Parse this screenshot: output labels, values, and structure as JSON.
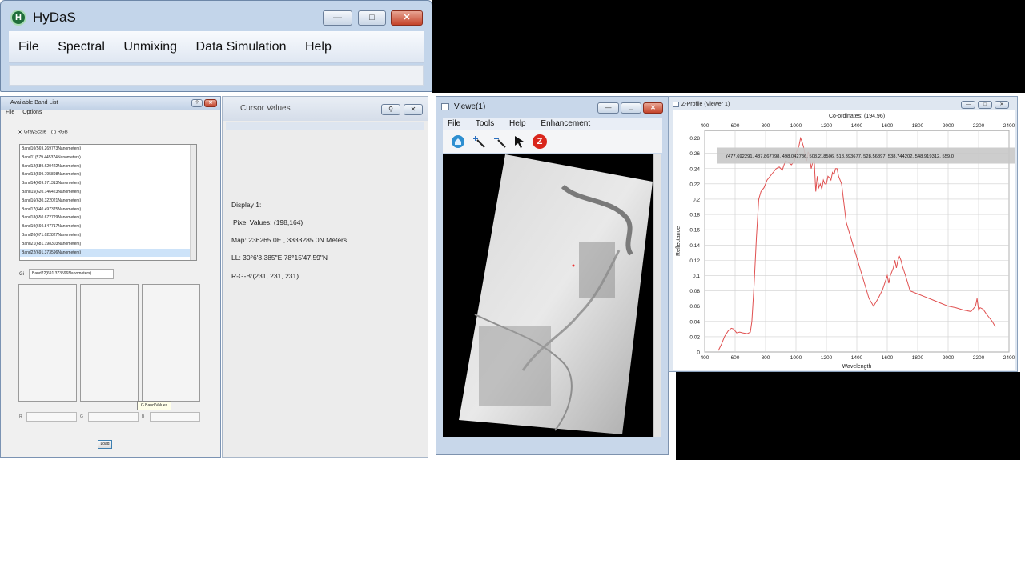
{
  "main_window": {
    "title": "HyDaS",
    "logo_glyph": "H",
    "controls": {
      "minimize": "—",
      "maximize": "□",
      "close": "✕"
    },
    "menu": [
      "File",
      "Spectral",
      "Unmixing",
      "Data Simulation",
      "Help"
    ]
  },
  "band_list_window": {
    "title": "Available Band List",
    "menu": [
      "File",
      "Options"
    ],
    "modes": [
      "GrayScale",
      "RGB"
    ],
    "selected_mode": "GrayScale",
    "bands": [
      "Band10(569.269773Nanometers)",
      "Band11(579.445374Nanometers)",
      "Band12(589.620422Nanometers)",
      "Band13(599.795898Nanometers)",
      "Band14(609.971313Nanometers)",
      "Band15(620.146423Nanometers)",
      "Band16(630.322021Nanometers)",
      "Band17(640.497375Nanometers)",
      "Band18(650.672729Nanometers)",
      "Band19(660.847717Nanometers)",
      "Band20(671.022827Nanometers)",
      "Band21(681.198303Nanometers)",
      "Band22(691.373596Nanometers)"
    ],
    "selected_band_index": 12,
    "gray_label": "Gi",
    "gray_value": "Band22(691.373596Nanometers)",
    "tooltip": "G Band Values",
    "value_labels": [
      "R",
      "G",
      "B"
    ],
    "load_label": "Load"
  },
  "cursor_window": {
    "title": "Cursor Values",
    "display": "Display 1:",
    "pixel": "Pixel Values: (198,164)",
    "map": "Map: 236265.0E , 3333285.0N Meters",
    "ll": "LL: 30°6'8.385\"E,78°15'47.59\"N",
    "rgb": "R-G-B:(231, 231, 231)"
  },
  "viewer_window": {
    "title": "Viewe(1)",
    "menu": [
      "File",
      "Tools",
      "Help",
      "Enhancement"
    ],
    "tools": [
      "home-icon",
      "zoom-in-icon",
      "zoom-out-icon",
      "pointer-icon",
      "z-icon"
    ],
    "z_glyph": "Z"
  },
  "zprofile_window": {
    "title": "Z-Profile (Viewer 1)",
    "coords": "Co-ordinates: (194,96)",
    "chart_data": {
      "type": "line",
      "xlabel": "Wavelength",
      "ylabel": "Reflectance",
      "xlim": [
        400,
        2400
      ],
      "ylim": [
        0,
        0.29
      ],
      "x_ticks": [
        400,
        600,
        800,
        1000,
        1200,
        1400,
        1600,
        1800,
        2000,
        2200,
        2400
      ],
      "y_ticks": [
        0,
        0.02,
        0.04,
        0.06,
        0.08,
        0.1,
        0.12,
        0.14,
        0.16,
        0.18,
        0.2,
        0.22,
        0.24,
        0.26,
        0.28
      ],
      "series": [
        {
          "color": "#e05050",
          "x": [
            490,
            510,
            530,
            555,
            575,
            590,
            610,
            630,
            650,
            680,
            700,
            710,
            725,
            740,
            755,
            770,
            790,
            810,
            830,
            850,
            870,
            890,
            910,
            930,
            950,
            970,
            990,
            1000,
            1010,
            1020,
            1030,
            1040,
            1050,
            1060,
            1070,
            1080,
            1090,
            1100,
            1110,
            1120,
            1130,
            1140,
            1150,
            1160,
            1170,
            1180,
            1190,
            1200,
            1210,
            1220,
            1230,
            1240,
            1250,
            1260,
            1270,
            1280,
            1290,
            1300,
            1330,
            1360,
            1390,
            1420,
            1450,
            1480,
            1510,
            1540,
            1570,
            1600,
            1610,
            1620,
            1630,
            1640,
            1650,
            1660,
            1670,
            1680,
            1690,
            1700,
            1720,
            1750,
            1800,
            1850,
            1900,
            1950,
            2000,
            2050,
            2100,
            2150,
            2180,
            2190,
            2200,
            2210,
            2230,
            2250,
            2270,
            2290,
            2310
          ],
          "values": [
            0.002,
            0.01,
            0.02,
            0.028,
            0.031,
            0.03,
            0.025,
            0.026,
            0.025,
            0.024,
            0.026,
            0.04,
            0.09,
            0.15,
            0.2,
            0.21,
            0.215,
            0.225,
            0.23,
            0.235,
            0.24,
            0.242,
            0.238,
            0.25,
            0.248,
            0.245,
            0.25,
            0.26,
            0.265,
            0.27,
            0.28,
            0.275,
            0.268,
            0.258,
            0.25,
            0.262,
            0.255,
            0.24,
            0.248,
            0.25,
            0.21,
            0.23,
            0.215,
            0.22,
            0.213,
            0.225,
            0.22,
            0.22,
            0.23,
            0.228,
            0.225,
            0.235,
            0.232,
            0.24,
            0.24,
            0.23,
            0.225,
            0.22,
            0.17,
            0.15,
            0.13,
            0.11,
            0.09,
            0.07,
            0.06,
            0.07,
            0.082,
            0.1,
            0.09,
            0.1,
            0.105,
            0.11,
            0.12,
            0.11,
            0.12,
            0.125,
            0.12,
            0.112,
            0.1,
            0.08,
            0.076,
            0.072,
            0.068,
            0.064,
            0.06,
            0.058,
            0.055,
            0.053,
            0.06,
            0.07,
            0.055,
            0.058,
            0.056,
            0.05,
            0.045,
            0.04,
            0.033
          ]
        }
      ],
      "annotation": "(477.692291, 487.867798, 498.042786, 508.218506, 518.393677, 528.56897, 538.744202, 548.919312, 559.0"
    }
  }
}
